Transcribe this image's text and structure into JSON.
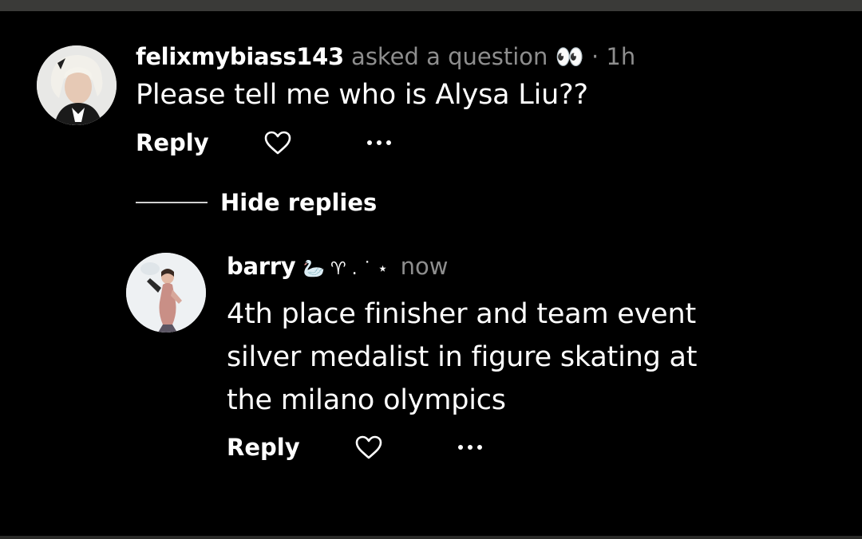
{
  "comment": {
    "username": "felixmybiass143",
    "activity": "asked a question",
    "activity_emoji": "👀",
    "separator": "·",
    "time": "1h",
    "text": "Please tell me who is Alysa Liu??",
    "reply_label": "Reply",
    "like_icon": "heart-outline-icon",
    "more_icon": "more-dots-icon"
  },
  "replies_toggle": {
    "label": "Hide replies"
  },
  "reply": {
    "username": "barry",
    "name_decoration": "🦢 ♈ . ˙ ⋆",
    "time": "now",
    "text_lines": [
      "4th place finisher and team event",
      "silver medalist in figure skating at",
      "the milano olympics"
    ],
    "reply_label": "Reply",
    "like_icon": "heart-outline-icon",
    "more_icon": "more-dots-icon"
  },
  "colors": {
    "background": "#000000",
    "text": "#ffffff",
    "muted": "#8e8e8e"
  }
}
